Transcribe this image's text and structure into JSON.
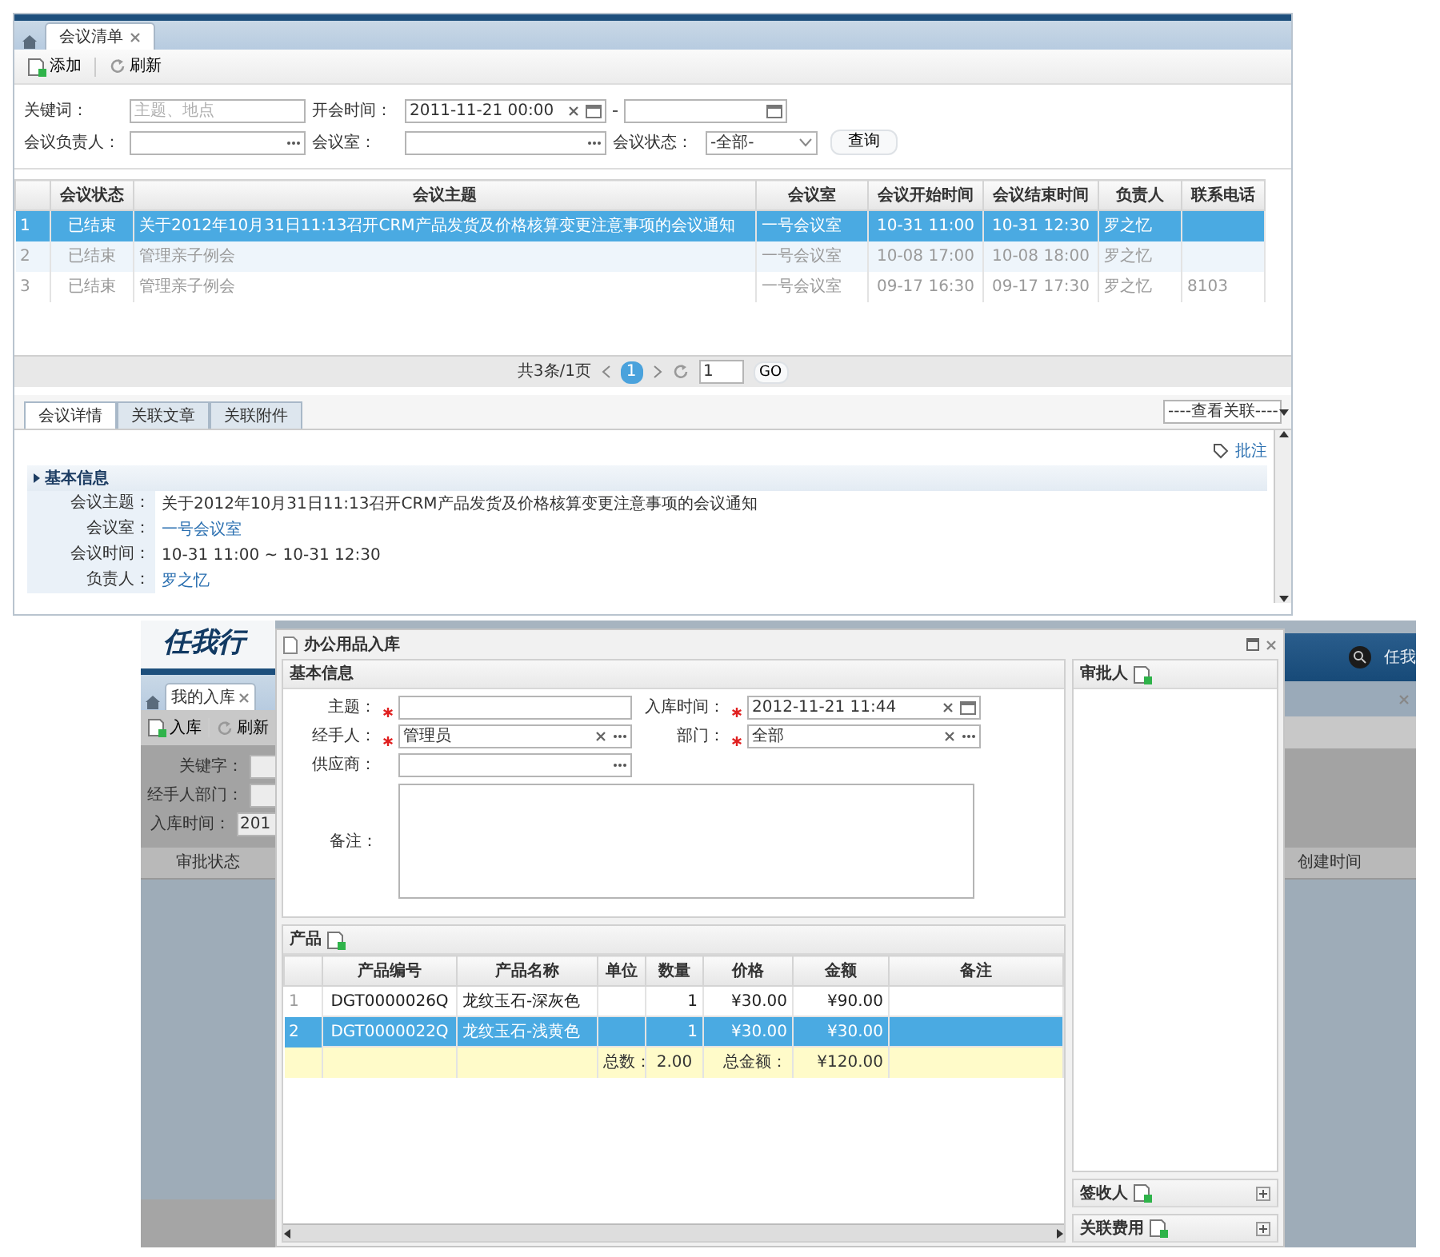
{
  "main_window": {
    "tabs": [
      {
        "label": "会议清单",
        "selected": true
      }
    ],
    "toolbar": [
      {
        "label": "添加",
        "kind": "add"
      },
      {
        "label": "刷新",
        "kind": "refresh"
      }
    ],
    "filters": {
      "keyword": {
        "label": "关键词：",
        "placeholder": "主题、地点"
      },
      "time": {
        "label": "开会时间：",
        "from": "2011-11-21 00:00"
      },
      "owner": {
        "label": "会议负责人："
      },
      "room": {
        "label": "会议室："
      },
      "status": {
        "label": "会议状态：",
        "value": "-全部-"
      },
      "search_button": "查询"
    },
    "table": {
      "columns": [
        "会议状态",
        "会议主题",
        "会议室",
        "会议开始时间",
        "会议结束时间",
        "负责人",
        "联系电话"
      ],
      "rows": [
        {
          "index": "1",
          "selected": true,
          "cells": [
            "已结束",
            "关于2012年10月31日11:13召开CRM产品发货及价格核算变更注意事项的会议通知",
            "一号会议室",
            "10-31 11:00",
            "10-31 12:30",
            "罗之忆",
            ""
          ]
        },
        {
          "index": "2",
          "selected": false,
          "cells": [
            "已结束",
            "管理亲子例会",
            "一号会议室",
            "10-08 17:00",
            "10-08 18:00",
            "罗之忆",
            ""
          ]
        },
        {
          "index": "3",
          "selected": false,
          "cells": [
            "已结束",
            "管理亲子例会",
            "一号会议室",
            "09-17 16:30",
            "09-17 17:30",
            "罗之忆",
            "8103"
          ]
        }
      ]
    },
    "pager": {
      "summary": "共3条/1页",
      "page": "1",
      "page_input": "1",
      "go": "GO"
    },
    "detail": {
      "tabs": [
        {
          "label": "会议详情",
          "selected": true
        },
        {
          "label": "关联文章",
          "selected": false
        },
        {
          "label": "关联附件",
          "selected": false
        }
      ],
      "relation_select": "----查看关联----",
      "annotate": "批注",
      "section": "基本信息",
      "fields": [
        {
          "label": "会议主题：",
          "value": "关于2012年10月31日11:13召开CRM产品发货及价格核算变更注意事项的会议通知",
          "kind": "text"
        },
        {
          "label": "会议室：",
          "value": "一号会议室",
          "kind": "link"
        },
        {
          "label": "会议时间：",
          "value": "10-31 11:00 ~ 10-31 12:30",
          "kind": "text"
        },
        {
          "label": "负责人：",
          "value": "罗之忆",
          "kind": "link"
        }
      ]
    }
  },
  "background_app": {
    "logo": "任我行",
    "user": "任我",
    "tabs": [
      {
        "label": "我的入库",
        "selected": true
      }
    ],
    "toolbar": [
      {
        "label": "入库",
        "kind": "add"
      },
      {
        "label": "刷新",
        "kind": "refresh"
      }
    ],
    "filters": [
      {
        "label": "关键字："
      },
      {
        "label": "经手人部门："
      },
      {
        "label": "入库时间：",
        "value": "201"
      }
    ],
    "left_column": "审批状态",
    "right_column": "创建时间"
  },
  "dialog": {
    "title": "办公用品入库",
    "basic": {
      "title": "基本信息",
      "fields": [
        {
          "label": "主题：",
          "required": true,
          "kind": "text"
        },
        {
          "label": "入库时间：",
          "required": true,
          "value": "2012-11-21 11:44",
          "kind": "date"
        },
        {
          "label": "经手人：",
          "required": true,
          "value": "管理员",
          "kind": "lookup"
        },
        {
          "label": "部门：",
          "required": true,
          "value": "全部",
          "kind": "lookup"
        },
        {
          "label": "供应商：",
          "required": false,
          "kind": "picker"
        }
      ],
      "note_label": "备注："
    },
    "products": {
      "title": "产品",
      "columns": [
        "产品编号",
        "产品名称",
        "单位",
        "数量",
        "价格",
        "金额",
        "备注"
      ],
      "rows": [
        {
          "index": "1",
          "selected": false,
          "cells": [
            "DGT0000026Q",
            "龙纹玉石-深灰色",
            "",
            "1",
            "¥30.00",
            "¥90.00",
            ""
          ]
        },
        {
          "index": "2",
          "selected": true,
          "cells": [
            "DGT0000022Q",
            "龙纹玉石-浅黄色",
            "",
            "1",
            "¥30.00",
            "¥30.00",
            ""
          ]
        }
      ],
      "totals": {
        "count_label": "总数：",
        "count": "2.00",
        "amount_label": "总金额：",
        "amount": "¥120.00"
      }
    },
    "side": {
      "approvers": "审批人",
      "receivers": "签收人",
      "expenses": "关联费用"
    }
  }
}
